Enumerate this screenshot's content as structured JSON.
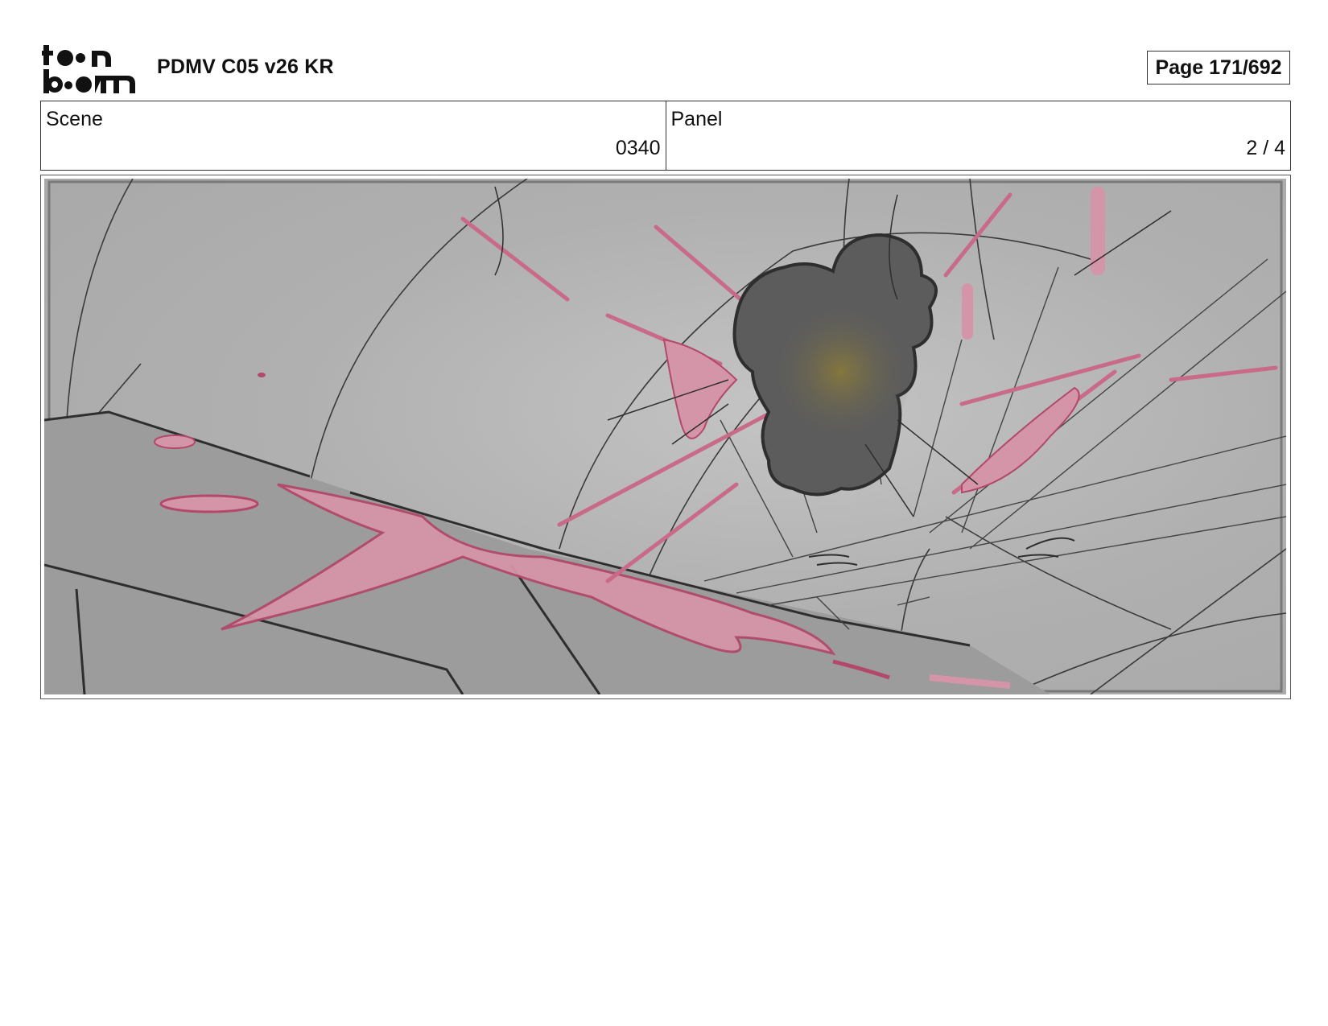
{
  "header": {
    "logo_lines": [
      "toon",
      "boom"
    ],
    "title": "PDMV C05 v26 KR",
    "page_label": "Page 171/692"
  },
  "info": {
    "scene_label": "Scene",
    "scene_value": "0340",
    "panel_label": "Panel",
    "panel_value": "2 / 4"
  },
  "panel": {
    "image_icon": "storyboard-sketch",
    "colors": {
      "background": "#b4b4b4",
      "floor": "#9c9c9c",
      "smoke": "#5c5c5c",
      "glow": "#8a7a3a",
      "blood_fill": "#d595a8",
      "blood_line": "#b2486a",
      "line": "#3a3a3a"
    }
  }
}
